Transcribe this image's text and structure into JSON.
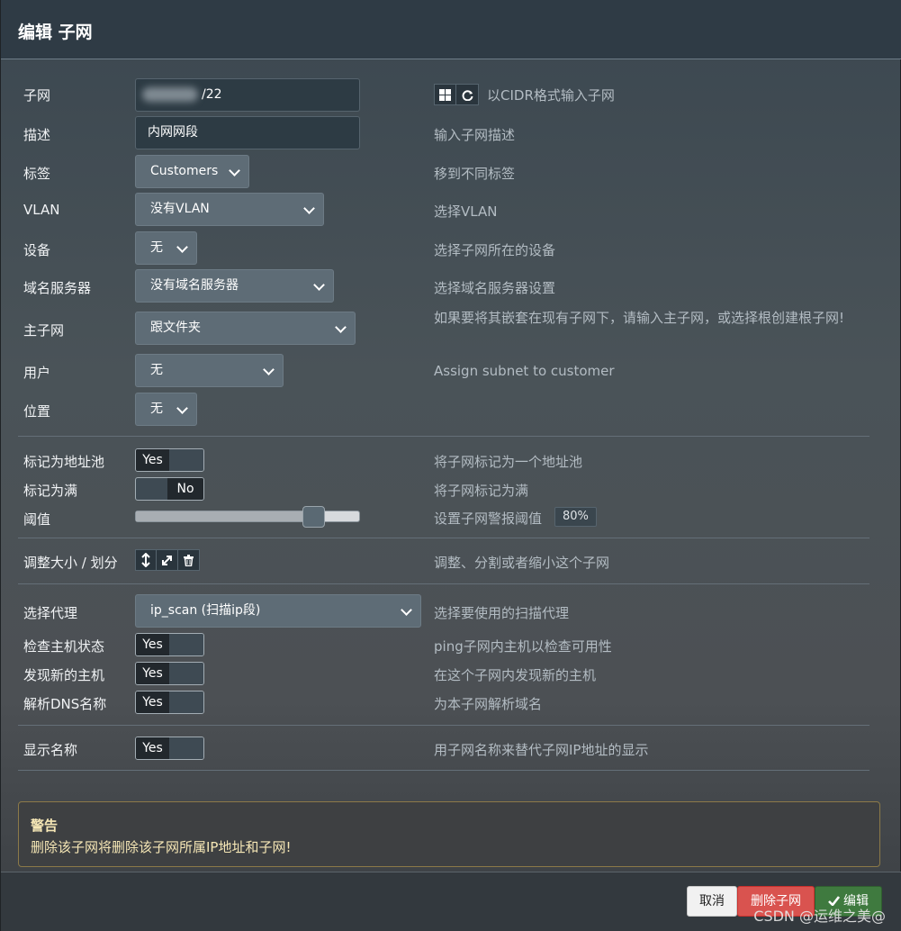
{
  "dialog": {
    "title": "编辑 子网"
  },
  "subnet": {
    "label": "子网",
    "value_suffix": "/22",
    "hint": "以CIDR格式输入子网",
    "icons": [
      "grid-icon",
      "refresh-icon"
    ]
  },
  "description": {
    "label": "描述",
    "value": "内网网段",
    "hint": "输入子网描述"
  },
  "section": {
    "label": "标签",
    "value": "Customers",
    "hint": "移到不同标签"
  },
  "vlan": {
    "label": "VLAN",
    "value": "没有VLAN",
    "hint": "选择VLAN"
  },
  "device": {
    "label": "设备",
    "value": "无",
    "hint": "选择子网所在的设备"
  },
  "nameserver": {
    "label": "域名服务器",
    "value": "没有域名服务器",
    "hint": "选择域名服务器设置"
  },
  "master": {
    "label": "主子网",
    "value": "跟文件夹",
    "hint": "如果要将其嵌套在现有子网下，请输入主子网，或选择根创建根子网!"
  },
  "customer": {
    "label": "用户",
    "value": "无",
    "hint": "Assign subnet to customer"
  },
  "location": {
    "label": "位置",
    "value": "无"
  },
  "pool": {
    "label": "标记为地址池",
    "toggle": "Yes",
    "hint": "将子网标记为一个地址池"
  },
  "full": {
    "label": "标记为满",
    "toggle": "No",
    "hint": "将子网标记为满"
  },
  "threshold": {
    "label": "阈值",
    "hint": "设置子网警报阈值",
    "percent_text": "80%",
    "value": 80
  },
  "resize": {
    "label": "调整大小 / 划分",
    "hint": "调整、分割或者缩小这个子网",
    "icons": [
      "resize-icon",
      "expand-icon",
      "trash-icon"
    ]
  },
  "agent": {
    "label": "选择代理",
    "value": "ip_scan (扫描ip段)",
    "hint": "选择要使用的扫描代理"
  },
  "ping_check": {
    "label": "检查主机状态",
    "toggle": "Yes",
    "hint": "ping子网内主机以检查可用性"
  },
  "discover": {
    "label": "发现新的主机",
    "toggle": "Yes",
    "hint": "在这个子网内发现新的主机"
  },
  "resolve_dns": {
    "label": "解析DNS名称",
    "toggle": "Yes",
    "hint": "为本子网解析域名"
  },
  "show_name": {
    "label": "显示名称",
    "toggle": "Yes",
    "hint": "用子网名称来替代子网IP地址的显示"
  },
  "warning": {
    "title": "警告",
    "text": "删除该子网将删除该子网所属IP地址和子网!"
  },
  "footer": {
    "cancel": "取消",
    "delete": "删除子网",
    "save": "编辑"
  },
  "watermark": "CSDN @运维之美@",
  "colors": {
    "danger": "#d9534f",
    "success": "#3f7a3f",
    "header": "#2f3b45"
  }
}
